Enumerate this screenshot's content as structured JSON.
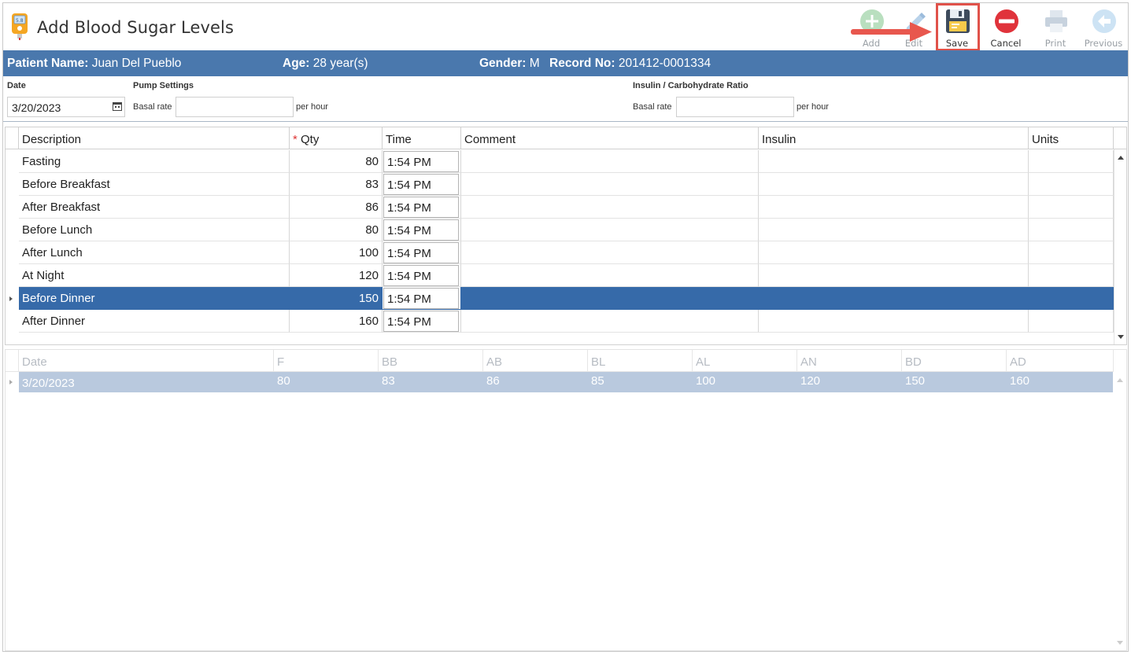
{
  "app": {
    "title": "Add Blood Sugar Levels"
  },
  "toolbar": {
    "add_label": "Add",
    "edit_label": "Edit",
    "save_label": "Save",
    "cancel_label": "Cancel",
    "print_label": "Print",
    "previous_label": "Previous"
  },
  "patient": {
    "name_key": "Patient Name:",
    "name_value": "Juan Del Pueblo",
    "age_key": "Age:",
    "age_value": "28 year(s)",
    "gender_key": "Gender:",
    "gender_value": "M",
    "record_key": "Record No:",
    "record_value": "201412-0001334"
  },
  "settings": {
    "date_label": "Date",
    "date_value": "3/20/2023",
    "pump_label": "Pump Settings",
    "pump_basal_label": "Basal rate",
    "pump_basal_value": "",
    "pump_unit": "per hour",
    "ratio_label": "Insulin / Carbohydrate Ratio",
    "ratio_basal_label": "Basal rate",
    "ratio_basal_value": "",
    "ratio_unit": "per hour"
  },
  "grid": {
    "headers": {
      "description": "Description",
      "qty_required": "*",
      "qty": "Qty",
      "time": "Time",
      "comment": "Comment",
      "insulin": "Insulin",
      "units": "Units"
    },
    "rows": [
      {
        "description": "Fasting",
        "qty": "80",
        "time": "1:54 PM",
        "comment": "",
        "insulin": "",
        "units": ""
      },
      {
        "description": "Before Breakfast",
        "qty": "83",
        "time": "1:54 PM",
        "comment": "",
        "insulin": "",
        "units": ""
      },
      {
        "description": "After Breakfast",
        "qty": "86",
        "time": "1:54 PM",
        "comment": "",
        "insulin": "",
        "units": ""
      },
      {
        "description": "Before Lunch",
        "qty": "80",
        "time": "1:54 PM",
        "comment": "",
        "insulin": "",
        "units": ""
      },
      {
        "description": "After Lunch",
        "qty": "100",
        "time": "1:54 PM",
        "comment": "",
        "insulin": "",
        "units": ""
      },
      {
        "description": "At Night",
        "qty": "120",
        "time": "1:54 PM",
        "comment": "",
        "insulin": "",
        "units": ""
      },
      {
        "description": "Before Dinner",
        "qty": "150",
        "time": "1:54 PM",
        "comment": "",
        "insulin": "",
        "units": ""
      },
      {
        "description": "After Dinner",
        "qty": "160",
        "time": "1:54 PM",
        "comment": "",
        "insulin": "",
        "units": ""
      }
    ],
    "selected_index": 6
  },
  "summary": {
    "headers": [
      "Date",
      "F",
      "BB",
      "AB",
      "BL",
      "AL",
      "AN",
      "BD",
      "AD"
    ],
    "row": [
      "3/20/2023",
      "80",
      "83",
      "86",
      "85",
      "100",
      "120",
      "150",
      "160"
    ]
  },
  "colors": {
    "accent": "#4a78ad",
    "selected_row": "#366aa9",
    "highlight": "#e0524a"
  }
}
